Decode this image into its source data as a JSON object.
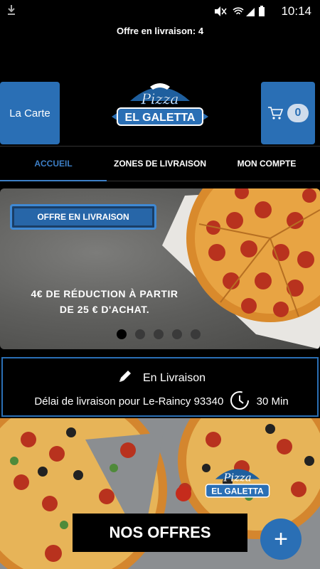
{
  "status_bar": {
    "time": "10:14",
    "icons": [
      "download-icon",
      "mute-icon",
      "wifi-icon",
      "signal-icon",
      "battery-icon"
    ]
  },
  "offer_line": "Offre en livraison: 4",
  "header": {
    "carte_label": "La Carte",
    "cart_count": "0",
    "logo": {
      "script_text": "Pizza",
      "brand_text": "EL GALETTA"
    }
  },
  "tabs": [
    {
      "label": "ACCUEIL",
      "active": true
    },
    {
      "label": "ZONES DE LIVRAISON",
      "active": false
    },
    {
      "label": "MON COMPTE",
      "active": false
    }
  ],
  "banner": {
    "badge": "OFFRE EN LIVRAISON",
    "promo_line1": "4€ DE RÉDUCTION À PARTIR",
    "promo_line2": "DE 25 € D'ACHAT.",
    "slides": 5,
    "active_slide": 0
  },
  "delivery": {
    "mode": "En Livraison",
    "text": "Délai de livraison pour Le-Raincy 93340",
    "time": "30 Min"
  },
  "bottom": {
    "nos_offres": "NOS OFFRES",
    "fab": "+",
    "logo": {
      "script_text": "Pizza",
      "brand_text": "EL GALETTA"
    }
  },
  "colors": {
    "accent": "#2a6fb5",
    "active_tab": "#3d7fc6",
    "background": "#000000"
  }
}
